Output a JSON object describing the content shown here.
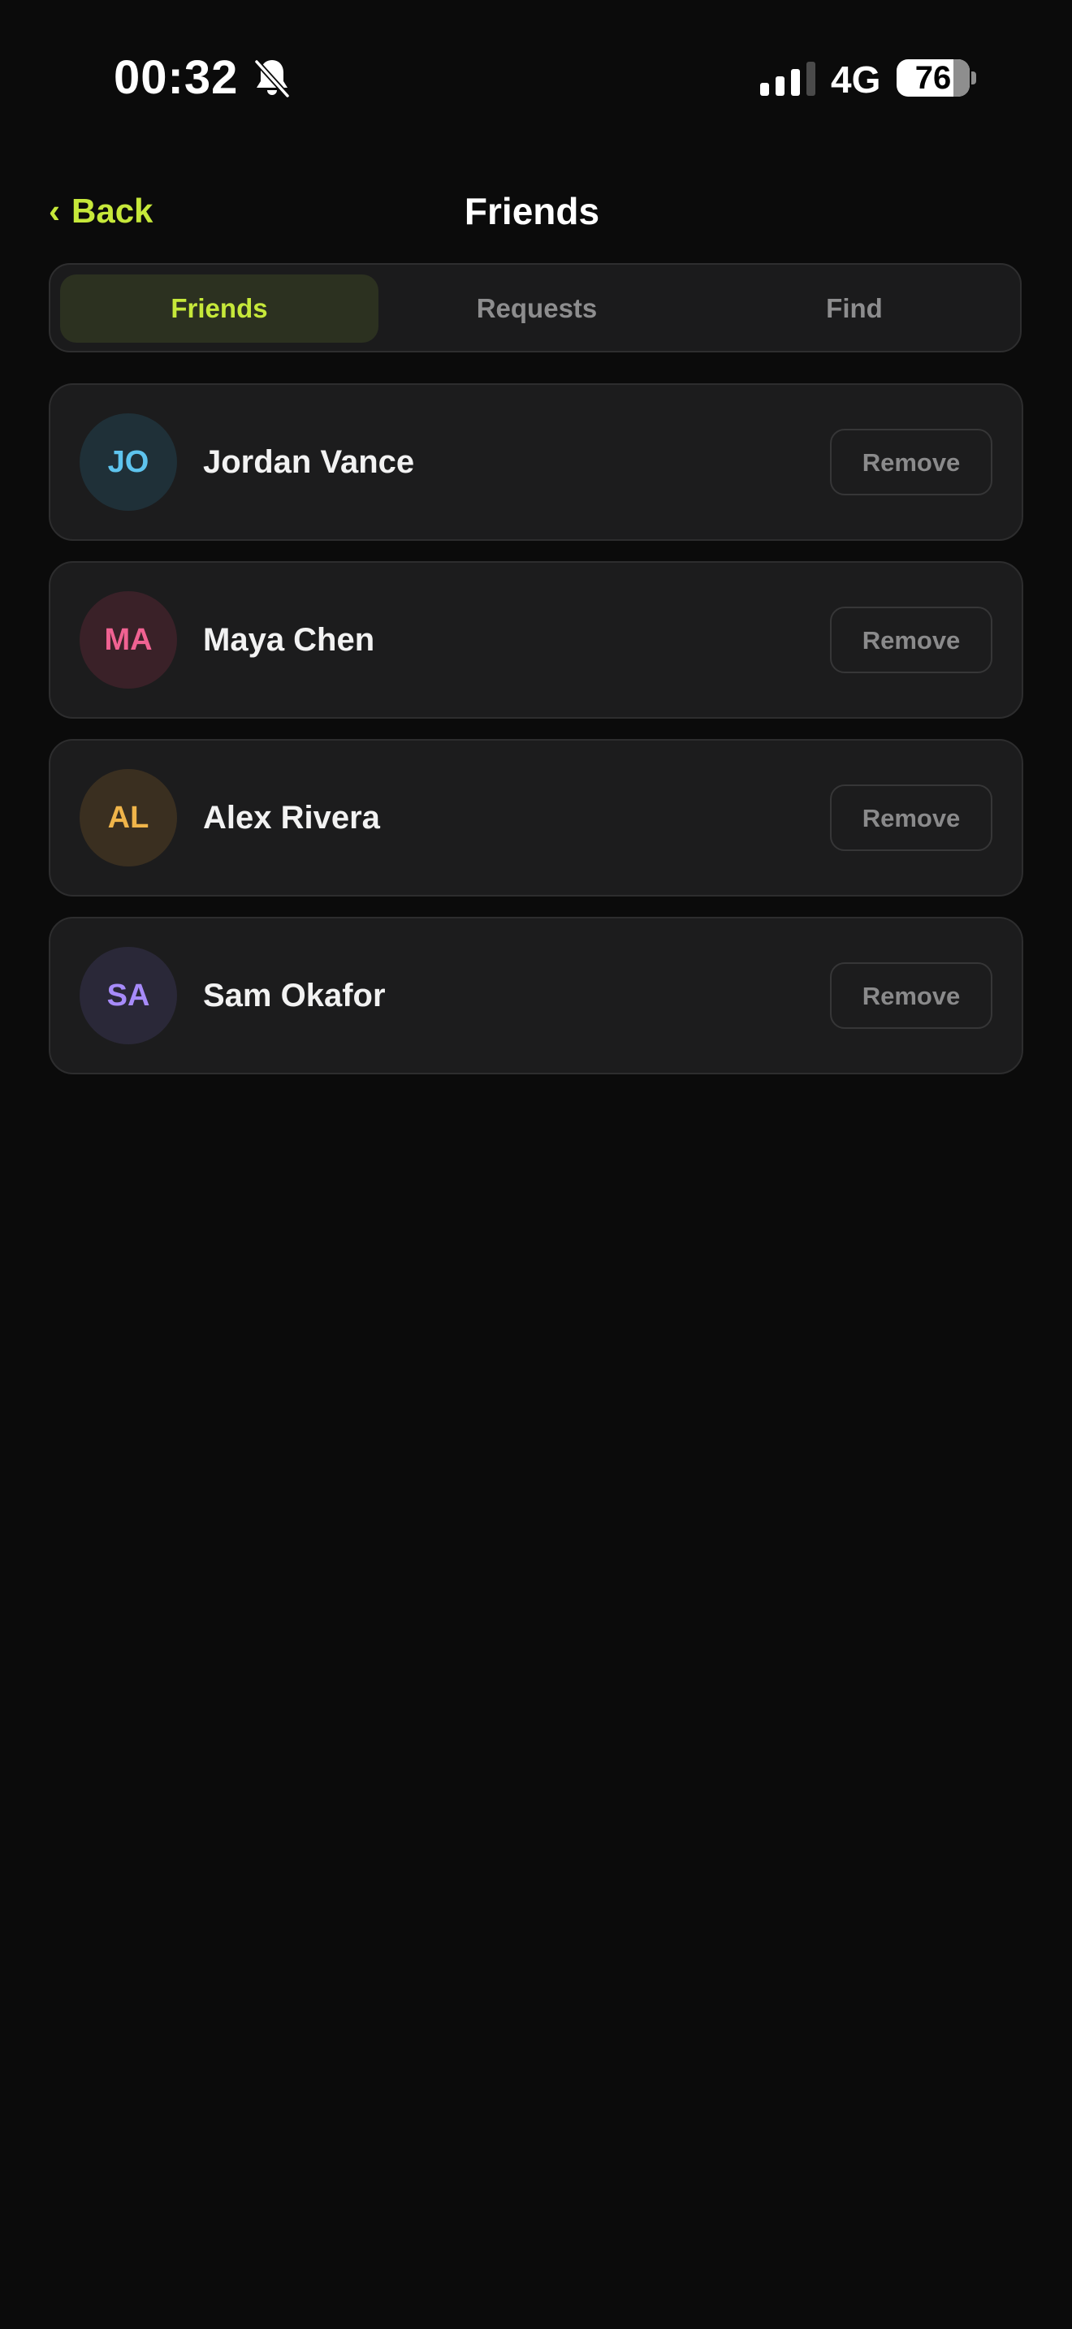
{
  "status_bar": {
    "time": "00:32",
    "network": "4G",
    "battery_level": "76",
    "battery_fraction": 0.76,
    "signal_bars_active": 3,
    "signal_bars_total": 4,
    "silent_icon": "bell-slash-icon"
  },
  "nav": {
    "back_chevron": "‹",
    "back_label": "Back",
    "title": "Friends"
  },
  "tabs": [
    {
      "label": "Friends",
      "active": true
    },
    {
      "label": "Requests",
      "active": false
    },
    {
      "label": "Find",
      "active": false
    }
  ],
  "friends": [
    {
      "initials": "JO",
      "name": "Jordan Vance",
      "action": "Remove",
      "avatar_bg": "#1f3038",
      "avatar_fg": "#5ec4ee"
    },
    {
      "initials": "MA",
      "name": "Maya Chen",
      "action": "Remove",
      "avatar_bg": "#3a2128",
      "avatar_fg": "#f06292"
    },
    {
      "initials": "AL",
      "name": "Alex Rivera",
      "action": "Remove",
      "avatar_bg": "#3a2f20",
      "avatar_fg": "#f0b54a"
    },
    {
      "initials": "SA",
      "name": "Sam Okafor",
      "action": "Remove",
      "avatar_bg": "#2a2838",
      "avatar_fg": "#a78bfa"
    }
  ],
  "colors": {
    "accent": "#c6e83a",
    "background": "#0b0b0b",
    "card": "#1c1c1d"
  }
}
